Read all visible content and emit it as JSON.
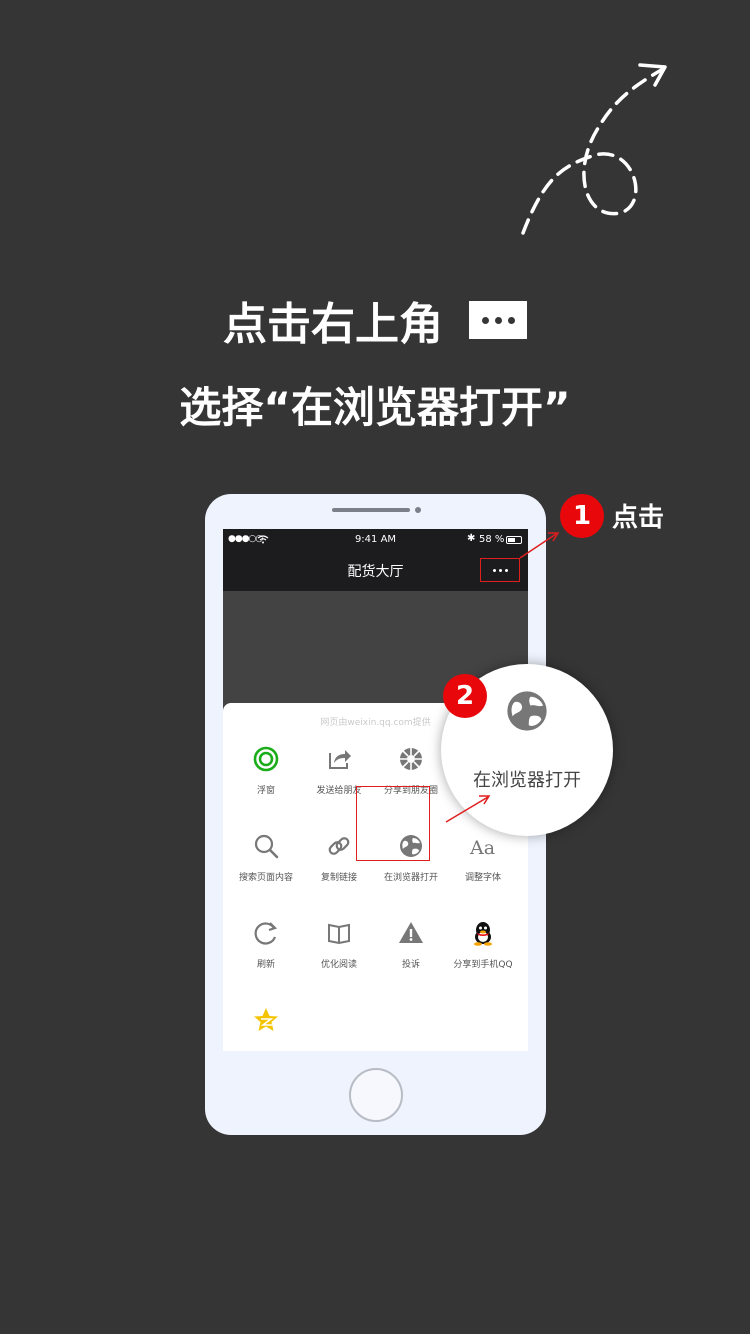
{
  "headline": {
    "line1": "点击右上角",
    "line2": "选择“在浏览器打开”"
  },
  "step1": {
    "number": "1",
    "label": "点击"
  },
  "step2": {
    "number": "2"
  },
  "status_bar": {
    "signal": "●●●○○",
    "time": "9:41 AM",
    "battery": "58 %"
  },
  "nav": {
    "title": "配货大厅"
  },
  "sheet": {
    "source": "网页由weixin.qq.com提供",
    "items": [
      {
        "label": "浮窗",
        "icon": "floating-window-icon"
      },
      {
        "label": "发送给朋友",
        "icon": "share-icon"
      },
      {
        "label": "分享到朋友圈",
        "icon": "moments-icon"
      },
      {
        "label": "搜索页面内容",
        "icon": "search-icon"
      },
      {
        "label": "复制链接",
        "icon": "link-icon"
      },
      {
        "label": "在浏览器打开",
        "icon": "globe-icon"
      },
      {
        "label": "调整字体",
        "icon": "font-icon"
      },
      {
        "label": "刷新",
        "icon": "refresh-icon"
      },
      {
        "label": "优化阅读",
        "icon": "book-icon"
      },
      {
        "label": "投诉",
        "icon": "warning-icon"
      },
      {
        "label": "分享到手机QQ",
        "icon": "qq-icon"
      },
      {
        "label": "",
        "icon": "qzone-star-icon"
      }
    ]
  },
  "callout": {
    "label": "在浏览器打开"
  },
  "colors": {
    "background": "#353535",
    "accent_red": "#e8080c",
    "wechat_green": "#1aad19",
    "qzone_yellow": "#f5c400"
  }
}
